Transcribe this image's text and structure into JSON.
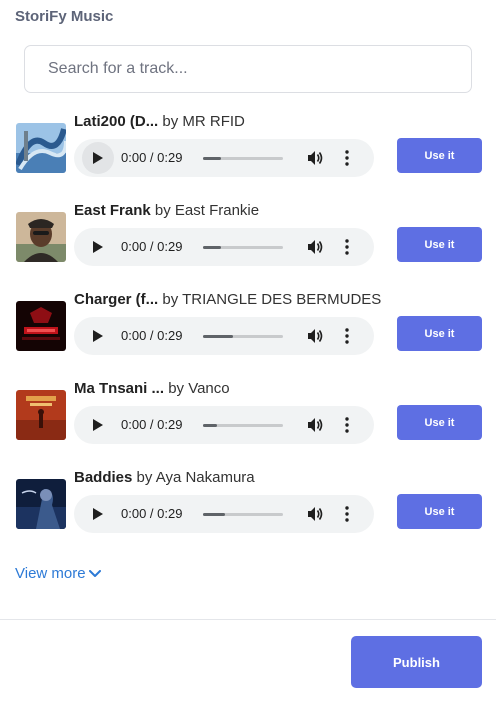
{
  "app": {
    "title": "StoriFy Music"
  },
  "search": {
    "placeholder": "Search for a track..."
  },
  "tracks": [
    {
      "name": "Lati200 (D...",
      "by_text": "by MR RFID",
      "time": "0:00 / 0:29",
      "progress": 0.22,
      "use_label": "Use it",
      "cover_icon": "water-slide-cover",
      "cover_colors": [
        "#3c6fb0",
        "#9cc3e6"
      ]
    },
    {
      "name": "East Frank",
      "by_text": "by East Frankie",
      "time": "0:00 / 0:29",
      "progress": 0.22,
      "use_label": "Use it",
      "cover_icon": "portrait-cover",
      "cover_colors": [
        "#b89a7a",
        "#4a3a30"
      ]
    },
    {
      "name": "Charger (f...",
      "by_text": "by TRIANGLE DES BERMUDES",
      "time": "0:00 / 0:29",
      "progress": 0.38,
      "use_label": "Use it",
      "cover_icon": "red-logo-cover",
      "cover_colors": [
        "#1a0505",
        "#c0131b"
      ]
    },
    {
      "name": "Ma Tnsani ...",
      "by_text": "by Vanco",
      "time": "0:00 / 0:29",
      "progress": 0.18,
      "use_label": "Use it",
      "cover_icon": "desert-figure-cover",
      "cover_colors": [
        "#b23a1c",
        "#e3a14a"
      ]
    },
    {
      "name": "Baddies",
      "by_text": "by Aya Nakamura",
      "time": "0:00 / 0:29",
      "progress": 0.28,
      "use_label": "Use it",
      "cover_icon": "night-portrait-cover",
      "cover_colors": [
        "#0f1e3c",
        "#3b5a8c"
      ]
    }
  ],
  "view_more": {
    "label": "View more"
  },
  "publish": {
    "label": "Publish"
  },
  "colors": {
    "accent": "#5e6fe3",
    "link": "#2d7ad6",
    "player_bg": "#f1f3f4"
  }
}
